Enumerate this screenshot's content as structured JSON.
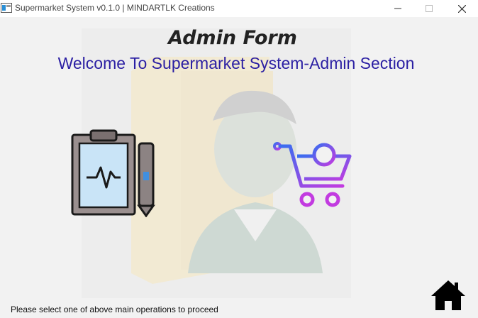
{
  "window": {
    "title": "Supermarket System v0.1.0 | MINDARTLK Creations"
  },
  "header": {
    "title": "Admin Form",
    "subtitle": "Welcome To Supermarket System-Admin Section"
  },
  "operations": [
    {
      "icon": "clipboard-pen-icon"
    },
    {
      "icon": "add-to-cart-icon"
    }
  ],
  "footer": {
    "status": "Please select one of above main operations to proceed",
    "home_icon": "home-icon"
  },
  "colors": {
    "subtitle": "#2b1fa3",
    "cart_gradient_start": "#3a6df0",
    "cart_gradient_end": "#c23be0"
  }
}
